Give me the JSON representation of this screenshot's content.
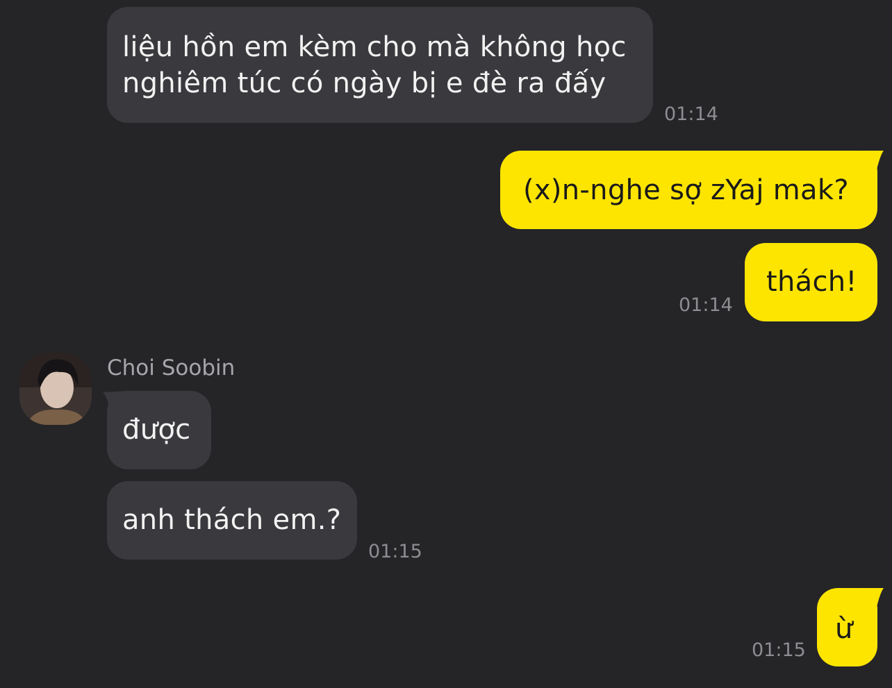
{
  "contact": {
    "name": "Choi Soobin",
    "avatar_icon": "person-photo-avatar"
  },
  "messages": [
    {
      "from": "contact",
      "lines": [
        "liệu hồn em kèm cho mà không học",
        "nghiêm túc có ngày bị e đè ra đấy"
      ],
      "time": "01:14"
    },
    {
      "from": "me",
      "text": "(x)n-nghe sợ zYaj mak?"
    },
    {
      "from": "me",
      "text": "thách!",
      "time": "01:14"
    },
    {
      "from": "contact",
      "text": "được"
    },
    {
      "from": "contact",
      "text": "anh thách em.?",
      "time": "01:15"
    },
    {
      "from": "me",
      "text": "ừ",
      "time": "01:15"
    }
  ],
  "colors": {
    "background": "#252528",
    "incoming_bubble": "#3a3a3e",
    "outgoing_bubble": "#fee500",
    "timestamp": "#8d8d92"
  }
}
